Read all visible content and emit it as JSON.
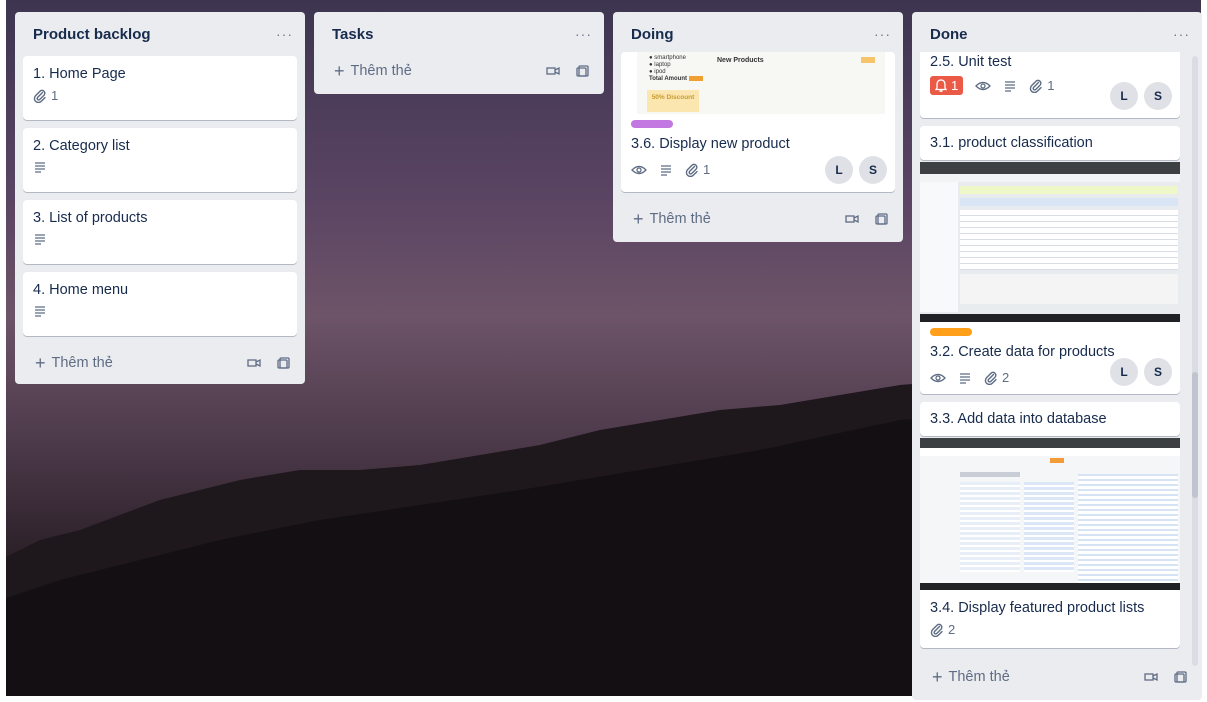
{
  "lists": [
    {
      "title": "Product backlog",
      "more": "···",
      "cards": [
        {
          "title": "1. Home Page",
          "attachments": "1"
        },
        {
          "title": "2. Category list"
        },
        {
          "title": "3. List of products"
        },
        {
          "title": "4. Home menu"
        }
      ],
      "add_card": "Thêm thẻ"
    },
    {
      "title": "Tasks",
      "more": "···",
      "cards": [],
      "add_card": "Thêm thẻ"
    },
    {
      "title": "Doing",
      "more": "···",
      "cover_preview": {
        "items": [
          "smartphone",
          "laptop",
          "ipod"
        ],
        "total_label": "Total Amount",
        "heading": "New Products",
        "discount": "50% Discount"
      },
      "cards": [
        {
          "title": "3.6. Display new product",
          "label_color": "#c377e0",
          "attachments": "1",
          "members": [
            "L",
            "S"
          ]
        }
      ],
      "add_card": "Thêm thẻ"
    },
    {
      "title": "Done",
      "more": "···",
      "cards": [
        {
          "title": "2.5. Unit test",
          "notifications": "1",
          "attachments": "1",
          "members": [
            "L",
            "S"
          ]
        },
        {
          "title": "3.1. product classification"
        },
        {
          "title": "3.2. Create data for products",
          "label_color": "#ff9f1a",
          "attachments": "2",
          "members": [
            "L",
            "S"
          ]
        },
        {
          "title": "3.3. Add data into database"
        },
        {
          "title": "3.4. Display featured product lists",
          "attachments": "2"
        }
      ],
      "add_card": "Thêm thẻ"
    }
  ],
  "colors": {
    "list_bg": "#ebecf0",
    "text": "#172b4d",
    "muted": "#5e6c84",
    "alert": "#eb5a46"
  },
  "icons": {
    "attachment": "paperclip-icon",
    "description": "description-icon",
    "watch": "eye-icon",
    "notification": "bell-icon",
    "template": "template-icon",
    "camera": "camera-icon"
  }
}
